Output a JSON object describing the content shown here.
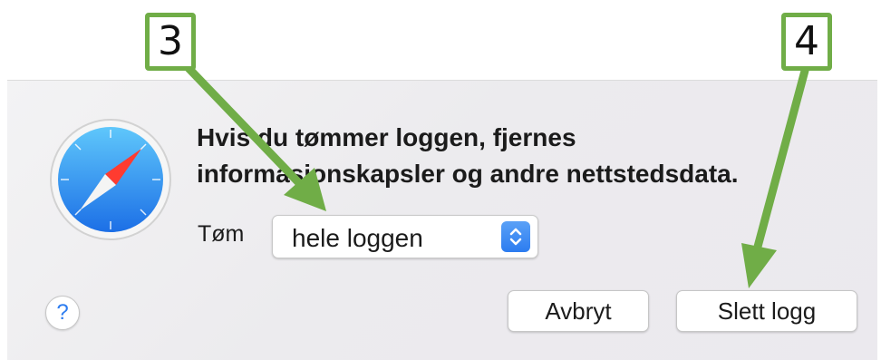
{
  "dialog": {
    "message_line1": "Hvis du tømmer loggen, fjernes",
    "message_line2": "informasjonskapsler og andre nettstedsdata.",
    "clear_label": "Tøm",
    "clear_select_value": "hele loggen",
    "cancel_label": "Avbryt",
    "delete_label": "Slett logg",
    "help_label": "?"
  },
  "annotations": {
    "step3_label": "3",
    "step4_label": "4",
    "arrow_color": "#70ad47"
  },
  "icons": {
    "app_icon": "safari-compass-icon",
    "select_arrows": "up-down-chevron-icon"
  }
}
